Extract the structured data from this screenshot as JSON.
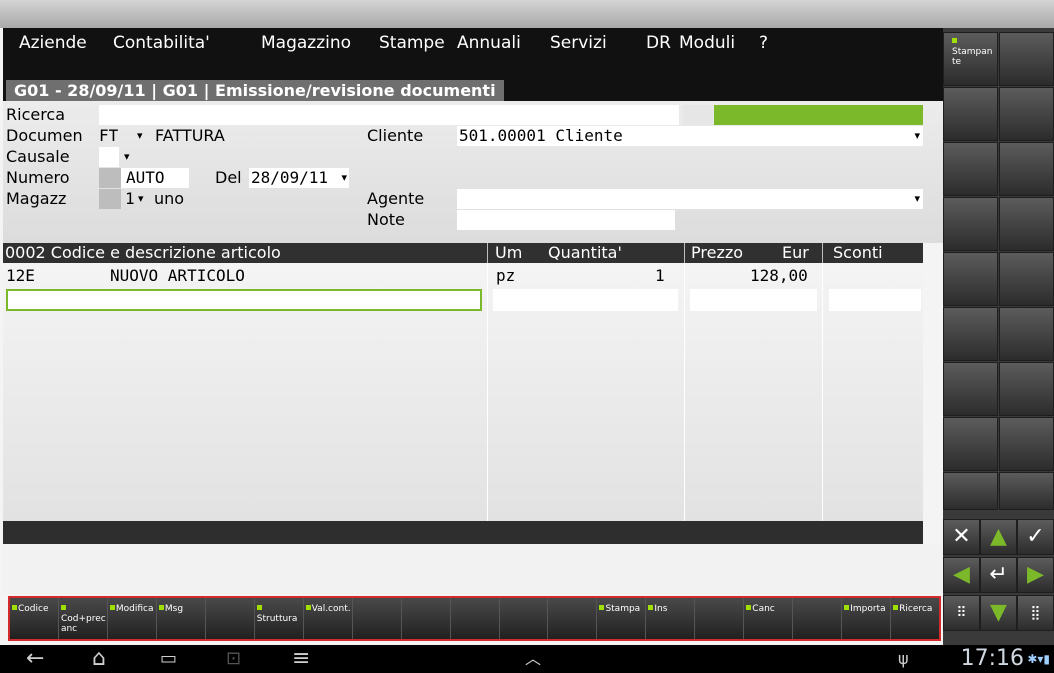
{
  "menu": [
    "Aziende",
    "Contabilita'",
    "Magazzino",
    "Stampe",
    "Annuali",
    "Servizi",
    "DR",
    "Moduli",
    "?"
  ],
  "window_title": "G01 - 28/09/11 | G01 | Emissione/revisione documenti",
  "form": {
    "ricerca_label": "Ricerca",
    "documento_label": "Documen",
    "documento_code": "FT",
    "documento_desc": "FATTURA",
    "causale_label": "Causale",
    "numero_label": "Numero",
    "numero_value": "AUTO",
    "del_label": "Del",
    "del_value": "28/09/11",
    "magazzino_label": "Magazz",
    "magazzino_value": "1",
    "magazzino_desc": "uno",
    "cliente_label": "Cliente",
    "cliente_value": "501.00001 Cliente",
    "agente_label": "Agente",
    "note_label": "Note"
  },
  "grid": {
    "headers": {
      "codice": "0002  Codice e descrizione articolo",
      "um": "Um",
      "quantita": "Quantita'",
      "prezzo": "Prezzo",
      "eur": "Eur",
      "sconti": "Sconti"
    },
    "rows": [
      {
        "code": "12E",
        "desc": "NUOVO ARTICOLO",
        "um": "pz",
        "qty": "1",
        "price": "128,00"
      }
    ]
  },
  "function_keys": [
    "Codice",
    "Cod+prec anc",
    "Modifica",
    "Msg",
    "",
    "Struttura",
    "Val.cont.",
    "",
    "",
    "",
    "",
    "",
    "Stampa",
    "Ins",
    "",
    "Canc",
    "",
    "Importa",
    "Ricerca",
    ""
  ],
  "side_panel": {
    "stampante_label": "Stampan te"
  },
  "status_bar": {
    "clock": "17:16"
  },
  "colors": {
    "accent_green": "#7cb92a",
    "menu_bg": "#111111",
    "highlight_border": "#d42a2a"
  }
}
